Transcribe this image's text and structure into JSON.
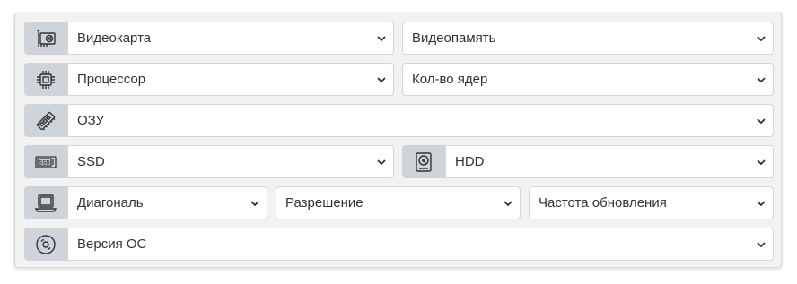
{
  "colors": {
    "panel_bg": "#f2f2f2",
    "icon_bg": "#cfd4da",
    "icon_stroke": "#333333",
    "text": "#333333"
  },
  "rows": {
    "gpu": {
      "icon": "video-card-icon",
      "select": "Видеокарта",
      "memory": "Видеопамять"
    },
    "cpu": {
      "icon": "cpu-chip-icon",
      "select": "Процессор",
      "cores": "Кол-во ядер"
    },
    "ram": {
      "icon": "ram-stick-icon",
      "select": "ОЗУ"
    },
    "storage": {
      "ssd_icon": "ssd-icon",
      "ssd": "SSD",
      "ssd_badge": "SSD",
      "hdd_icon": "hdd-icon",
      "hdd": "HDD"
    },
    "display": {
      "icon": "laptop-icon",
      "diagonal": "Диагональ",
      "resolution": "Разрешение",
      "refresh": "Частота обновления"
    },
    "os": {
      "icon": "disc-icon",
      "select": "Версия ОС"
    }
  }
}
